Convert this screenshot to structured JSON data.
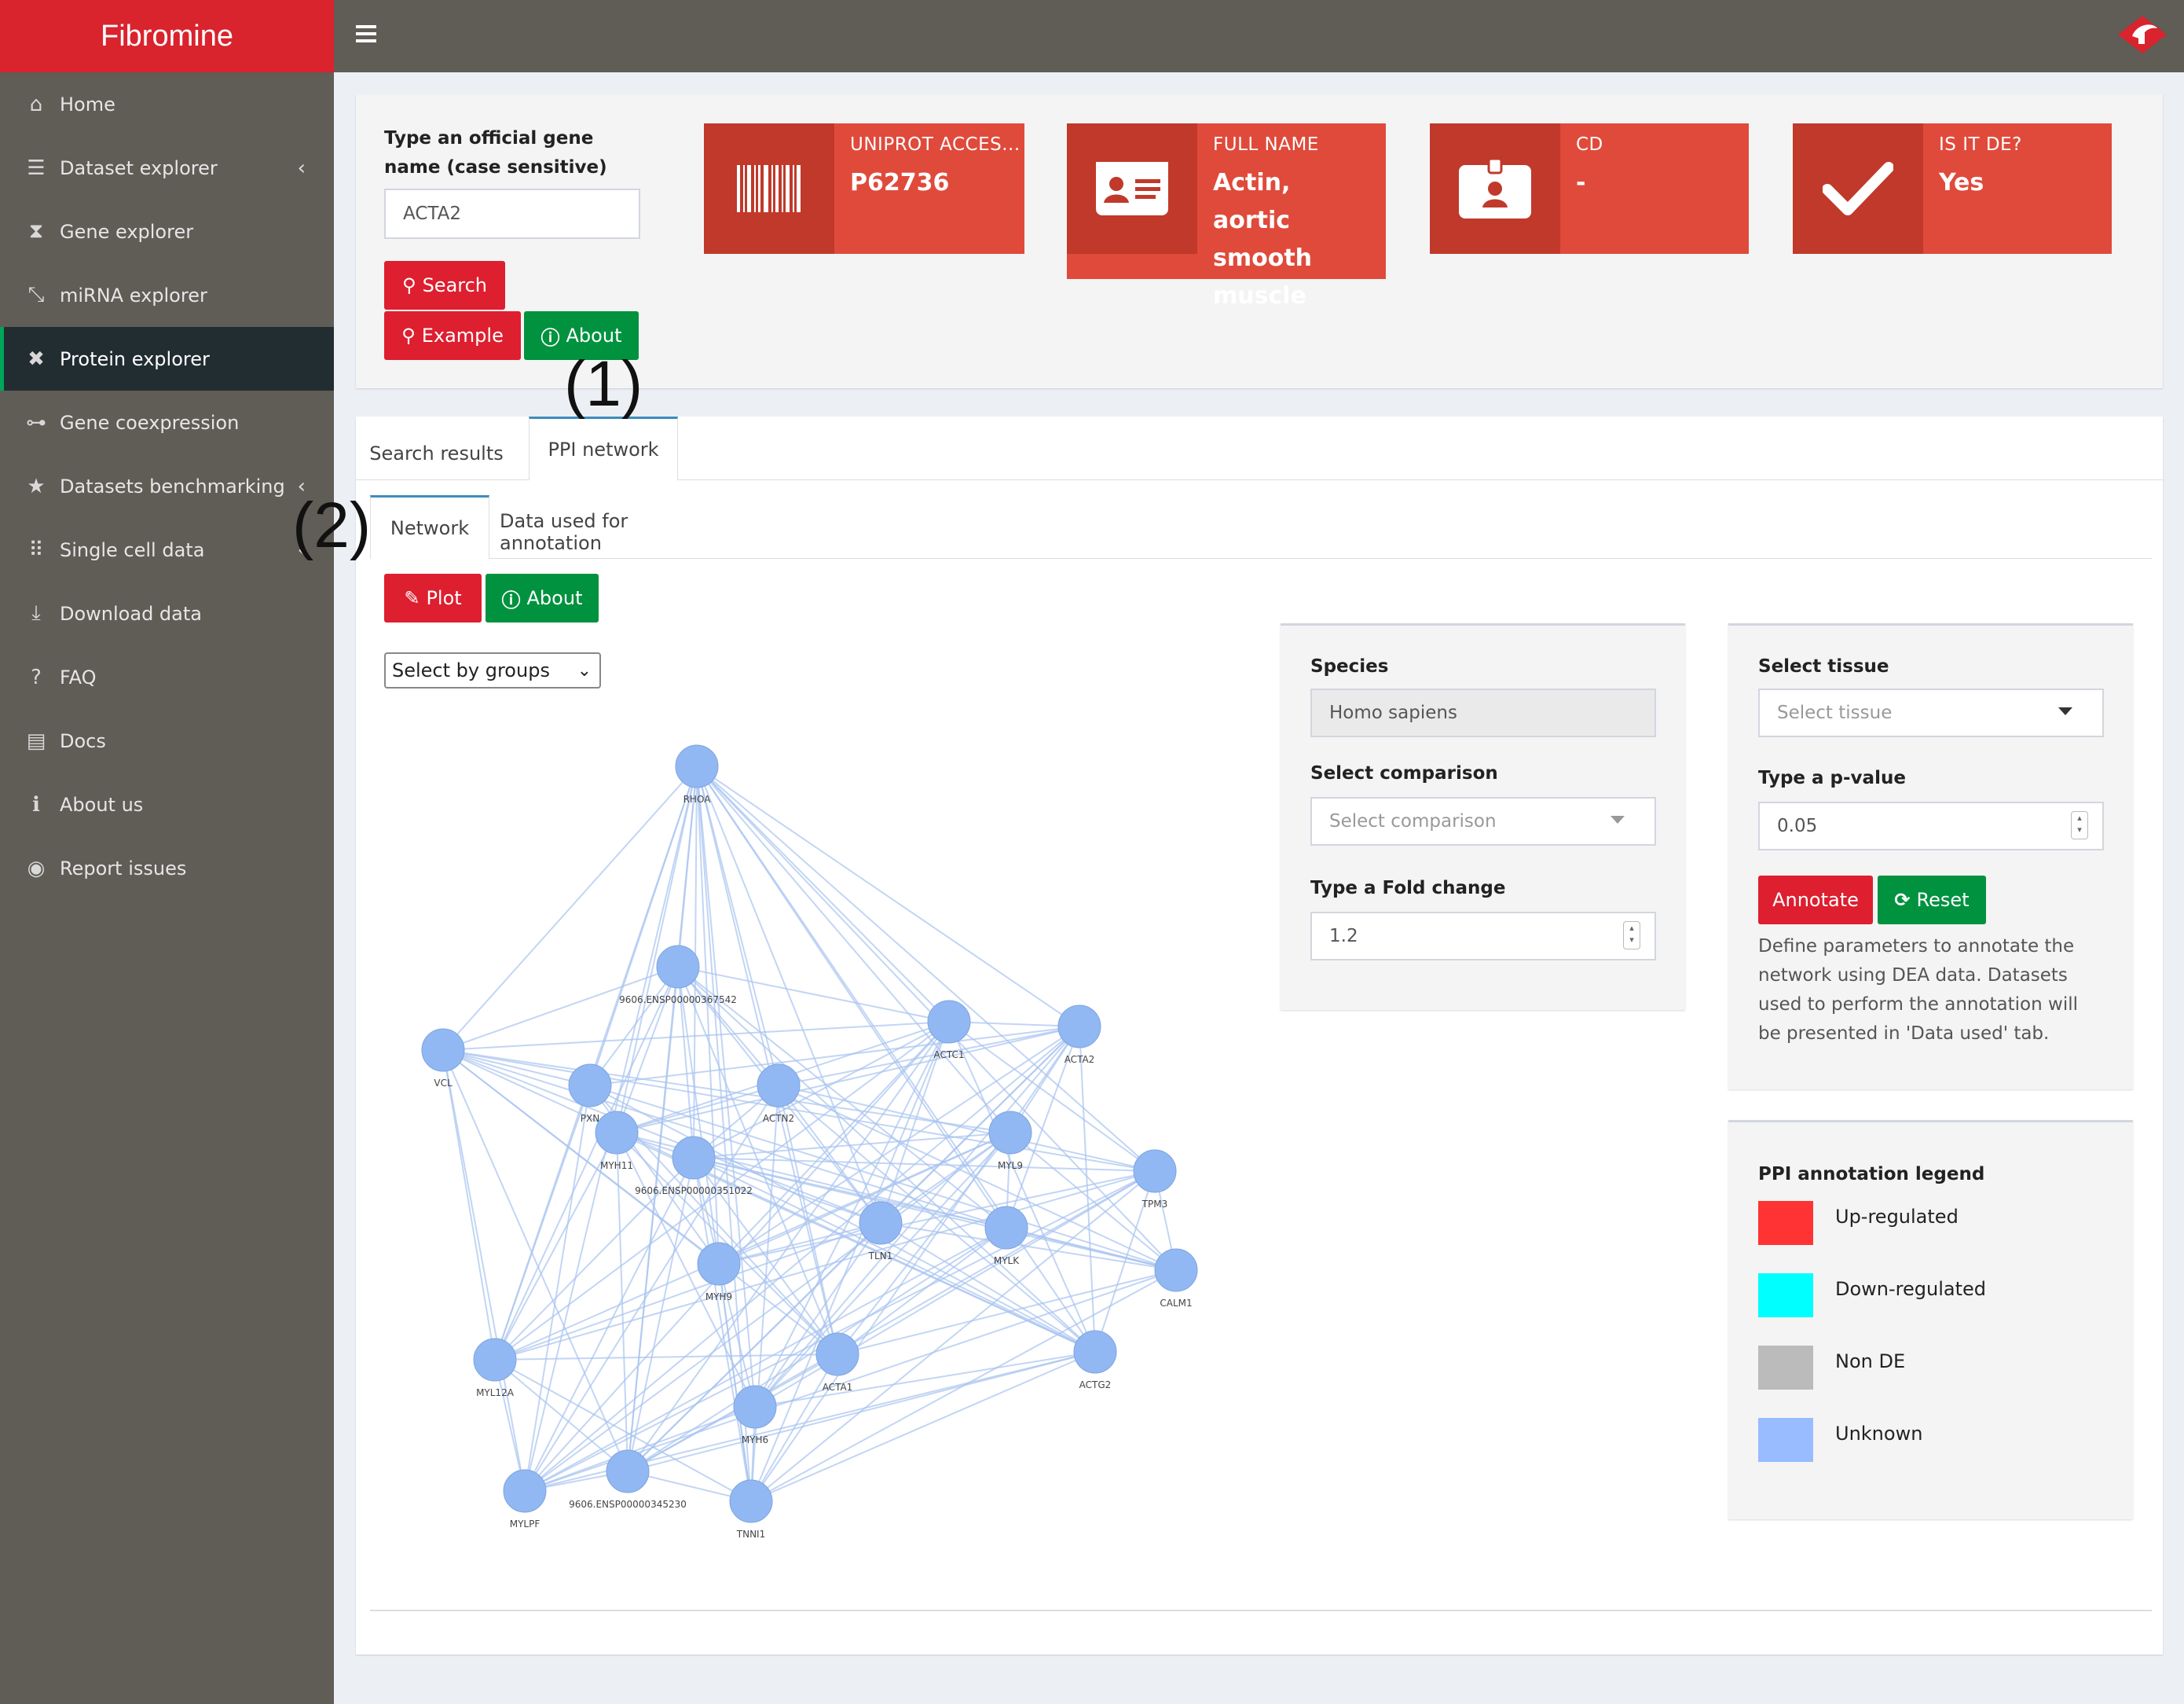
{
  "app": {
    "title": "Fibromine"
  },
  "sidebar": {
    "items": [
      {
        "label": "Home",
        "icon": "home-icon",
        "glyph": "⌂"
      },
      {
        "label": "Dataset explorer",
        "icon": "database-icon",
        "glyph": "☰",
        "chevron": "‹"
      },
      {
        "label": "Gene explorer",
        "icon": "dna-icon",
        "glyph": "⧗"
      },
      {
        "label": "miRNA explorer",
        "icon": "mirna-icon",
        "glyph": "⤡"
      },
      {
        "label": "Protein explorer",
        "icon": "network-icon",
        "glyph": "✖",
        "active": true
      },
      {
        "label": "Gene coexpression",
        "icon": "sitemap-icon",
        "glyph": "⊶"
      },
      {
        "label": "Datasets benchmarking",
        "icon": "star-icon",
        "glyph": "★",
        "chevron": "‹"
      },
      {
        "label": "Single cell data",
        "icon": "grid-dots-icon",
        "glyph": "⠿",
        "chevron": "‹"
      },
      {
        "label": "Download data",
        "icon": "download-icon",
        "glyph": "⤓"
      },
      {
        "label": "FAQ",
        "icon": "question-icon",
        "glyph": "?"
      },
      {
        "label": "Docs",
        "icon": "book-icon",
        "glyph": "▤"
      },
      {
        "label": "About us",
        "icon": "info-icon",
        "glyph": "ℹ"
      },
      {
        "label": "Report issues",
        "icon": "github-icon",
        "glyph": "◉"
      }
    ]
  },
  "search": {
    "label": "Type an official gene name (case sensitive)",
    "value": "ACTA2",
    "search_btn": "Search",
    "example_btn": "Example",
    "about_btn": "About"
  },
  "info_boxes": [
    {
      "label": "UNIPROT ACCES...",
      "value": "P62736",
      "icon": "barcode-icon"
    },
    {
      "label": "FULL NAME",
      "value": "Actin, aortic smooth muscle",
      "icon": "id-card-icon"
    },
    {
      "label": "CD",
      "value": "-",
      "icon": "id-badge-icon"
    },
    {
      "label": "IS IT DE?",
      "value": "Yes",
      "icon": "check-icon"
    }
  ],
  "tabs": {
    "outer": [
      "Search results",
      "PPI network"
    ],
    "inner": [
      "Network",
      "Data used for annotation"
    ]
  },
  "annotations": {
    "one": "(1)",
    "two": "(2)"
  },
  "network_panel": {
    "plot_btn": "Plot",
    "about_btn": "About",
    "group_select": "Select by groups"
  },
  "filters": {
    "species_label": "Species",
    "species_value": "Homo sapiens",
    "comparison_label": "Select comparison",
    "comparison_placeholder": "Select comparison",
    "fold_label": "Type a Fold change",
    "fold_value": "1.2",
    "tissue_label": "Select tissue",
    "tissue_placeholder": "Select tissue",
    "pvalue_label": "Type a p-value",
    "pvalue_value": "0.05",
    "annotate_btn": "Annotate",
    "reset_btn": "Reset",
    "help": "Define parameters to annotate the network using DEA data. Datasets used to perform the annotation will be presented in 'Data used' tab."
  },
  "legend": {
    "title": "PPI annotation legend",
    "items": [
      {
        "label": "Up-regulated",
        "color": "#ff3333"
      },
      {
        "label": "Down-regulated",
        "color": "#00ffff"
      },
      {
        "label": "Non DE",
        "color": "#bbbbbb"
      },
      {
        "label": "Unknown",
        "color": "#99bbff"
      }
    ]
  },
  "network_nodes": [
    "RHOA",
    "9606.ENSP00000367542",
    "ACTC1",
    "ACTA2",
    "VCL",
    "PXN",
    "ACTN2",
    "MYH11",
    "9606.ENSP00000351022",
    "MYL9",
    "TPM3",
    "TLN1",
    "MYLK",
    "CALM1",
    "MYH9",
    "MYL12A",
    "ACTA1",
    "ACTG2",
    "MYH6",
    "9606.ENSP00000345230",
    "MYLPF",
    "TNNI1"
  ]
}
